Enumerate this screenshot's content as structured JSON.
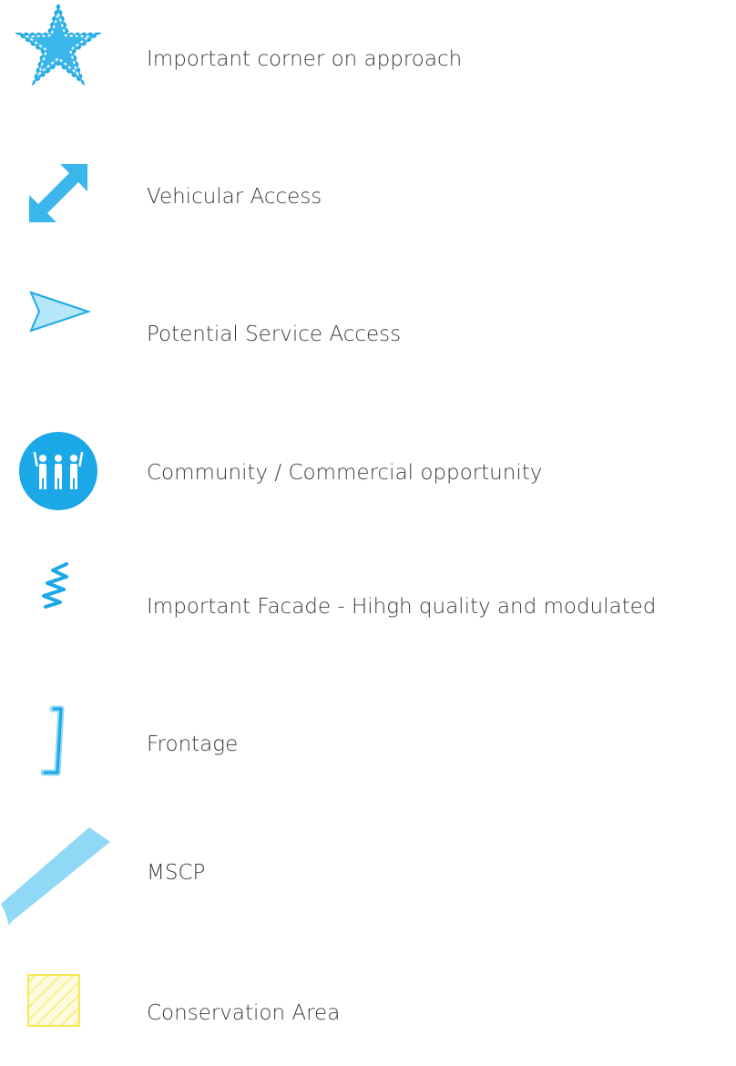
{
  "legend": {
    "items": [
      {
        "label": "Important corner on approach",
        "icon": "star-icon"
      },
      {
        "label": "Vehicular Access",
        "icon": "double-arrow-icon"
      },
      {
        "label": "Potential Service Access",
        "icon": "arrowhead-icon"
      },
      {
        "label": "Community / Commercial opportunity",
        "icon": "people-icon"
      },
      {
        "label": "Important Facade - Hihgh quality and modulated",
        "icon": "zigzag-icon"
      },
      {
        "label": "Frontage",
        "icon": "bracket-icon"
      },
      {
        "label": "MSCP",
        "icon": "parking-bar-icon"
      },
      {
        "label": "Conservation Area",
        "icon": "hatched-square-icon"
      }
    ],
    "colors": {
      "blue": "#1ba8e6",
      "light_blue": "#8fd8f6",
      "pale_blue": "#b6e6f9",
      "yellow": "#f3ea52",
      "text": "#3b3b3b"
    }
  }
}
